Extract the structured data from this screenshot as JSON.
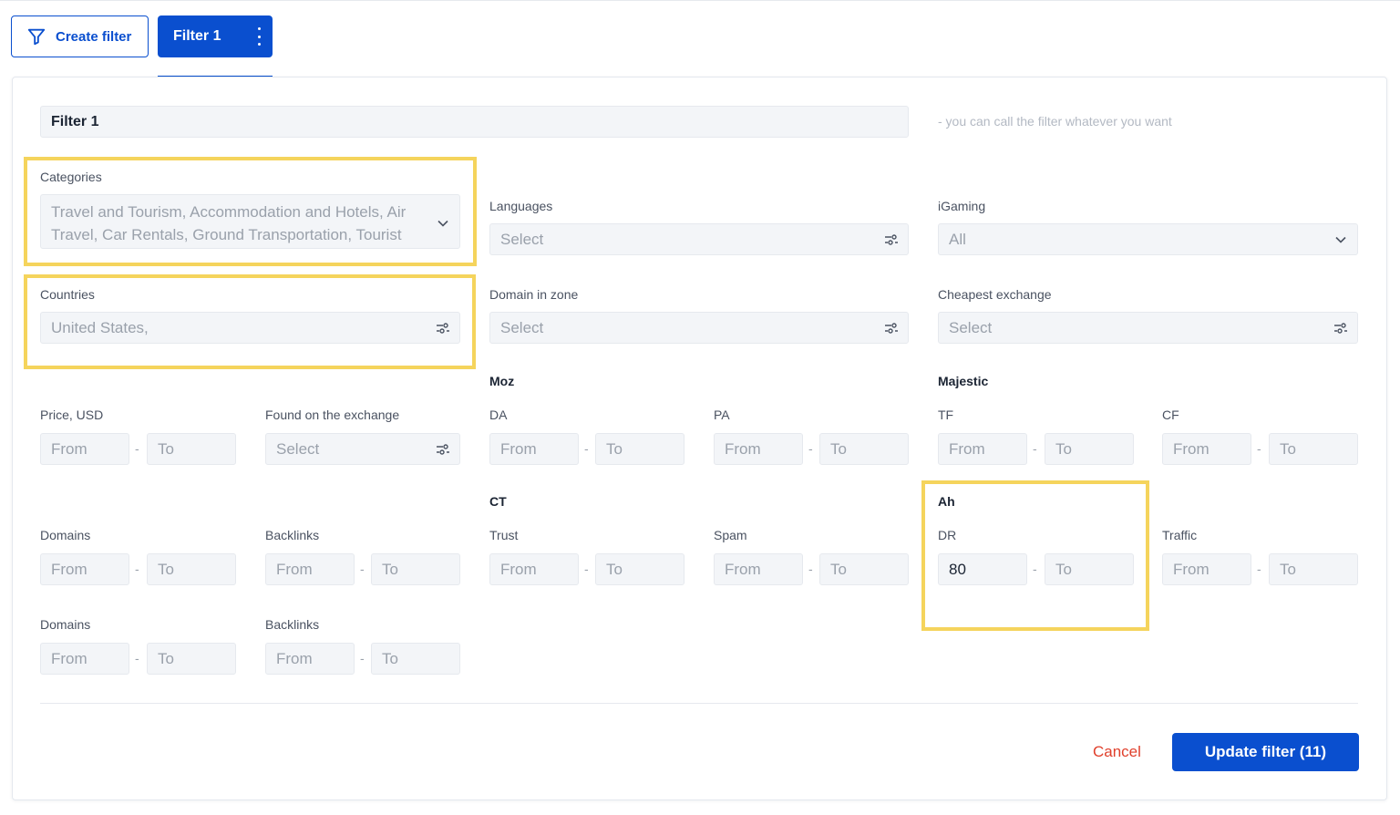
{
  "toolbar": {
    "create_filter_label": "Create filter",
    "active_tab_label": "Filter 1"
  },
  "form": {
    "name_value": "Filter 1",
    "name_hint": "- you can call the filter whatever you want",
    "categories": {
      "label": "Categories",
      "value": "Travel and Tourism, Accommodation and Hotels, Air Travel, Car Rentals, Ground Transportation, Tourist"
    },
    "languages": {
      "label": "Languages",
      "placeholder": "Select"
    },
    "igaming": {
      "label": "iGaming",
      "value": "All"
    },
    "countries": {
      "label": "Countries",
      "value": "United States,"
    },
    "domain_zone": {
      "label": "Domain in zone",
      "placeholder": "Select"
    },
    "cheapest_exchange": {
      "label": "Cheapest exchange",
      "placeholder": "Select"
    },
    "price": {
      "label": "Price, USD",
      "from": "From",
      "to": "To"
    },
    "found_exchange": {
      "label": "Found on the exchange",
      "placeholder": "Select"
    },
    "moz": {
      "title": "Moz",
      "da": {
        "label": "DA",
        "from": "From",
        "to": "To"
      },
      "pa": {
        "label": "PA",
        "from": "From",
        "to": "To"
      }
    },
    "majestic": {
      "title": "Majestic",
      "tf": {
        "label": "TF",
        "from": "From",
        "to": "To"
      },
      "cf": {
        "label": "CF",
        "from": "From",
        "to": "To"
      }
    },
    "domains1": {
      "label": "Domains",
      "from": "From",
      "to": "To"
    },
    "backlinks1": {
      "label": "Backlinks",
      "from": "From",
      "to": "To"
    },
    "ct": {
      "title": "CT",
      "trust": {
        "label": "Trust",
        "from": "From",
        "to": "To"
      },
      "spam": {
        "label": "Spam",
        "from": "From",
        "to": "To"
      }
    },
    "ah": {
      "title": "Ah",
      "dr": {
        "label": "DR",
        "from_value": "80",
        "to": "To"
      },
      "traffic": {
        "label": "Traffic",
        "from": "From",
        "to": "To"
      }
    },
    "domains2": {
      "label": "Domains",
      "from": "From",
      "to": "To"
    },
    "backlinks2": {
      "label": "Backlinks",
      "from": "From",
      "to": "To"
    },
    "range_separator": "-"
  },
  "actions": {
    "cancel_label": "Cancel",
    "update_label": "Update filter (11)"
  },
  "colors": {
    "primary": "#0a4fcf",
    "cancel": "#e0402c",
    "highlight": "#f5d45c"
  }
}
